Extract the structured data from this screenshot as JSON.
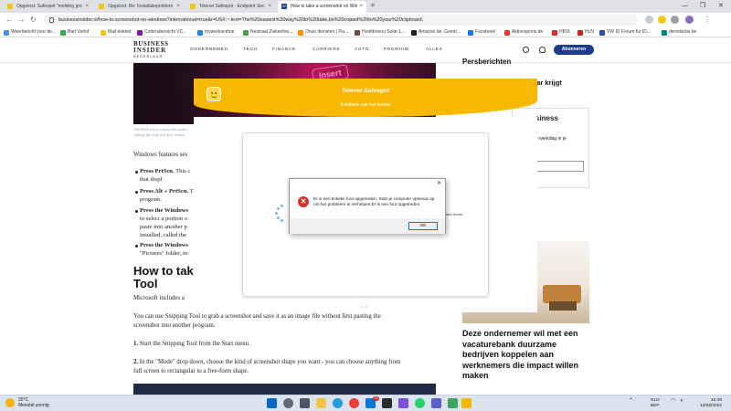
{
  "browser": {
    "tabs": [
      {
        "label": "Opgelost: Safespot \"melding gro",
        "color": "#f5c518"
      },
      {
        "label": "Opgelost: Re: Installatieproblem",
        "color": "#f5c518"
      },
      {
        "label": "Telenet Safespot - Endpoint Sec",
        "color": "#f5c518"
      },
      {
        "label": "How to take a screenshot on Win",
        "color": "#1d3b8b",
        "fav_text": "BI"
      }
    ],
    "url": "businessinsider.nl/how-to-screenshot-on-windows?international=true&r=US#:~:text=The%20easiest%20way%20to%20take,be%20copied%20to%20your%20clipboard.",
    "bookmarks": [
      {
        "label": "Weerbericht voor de...",
        "color": "#4a90d9"
      },
      {
        "label": "Bart Verlof",
        "color": "#34a853"
      },
      {
        "label": "Mail telenet",
        "color": "#f5c518"
      },
      {
        "label": "Coderubersicht VC...",
        "color": "#7b1fa2"
      },
      {
        "label": "mywerkandme",
        "color": "#1e88e5"
      },
      {
        "label": "Neutraal Ziekenfon...",
        "color": "#43a047"
      },
      {
        "label": "Onze diensten | Flu...",
        "color": "#fb8c00"
      },
      {
        "label": "Hoofdmenu Solar-L...",
        "color": "#6d4c41"
      },
      {
        "label": "Amazon.de: Goroti...",
        "color": "#222222"
      },
      {
        "label": "Facebook",
        "color": "#1877f2"
      },
      {
        "label": "Aktionspreis.de",
        "color": "#e53935"
      },
      {
        "label": "HBVL",
        "color": "#d32f2f"
      },
      {
        "label": "HLN",
        "color": "#c62828"
      },
      {
        "label": "VW ID Forum für ID...",
        "color": "#3949ab"
      },
      {
        "label": "deredactie.be",
        "color": "#00897b"
      }
    ]
  },
  "site": {
    "logo": {
      "line1": "BUSINESS",
      "line2": "INSIDER",
      "line3": "NEDERLAND"
    },
    "nav": [
      "ONDERNEMEN",
      "TECH",
      "FINANCE",
      "CARRIERE",
      "AUTO",
      "PREMIUM",
      "ALLES"
    ],
    "subscribe_label": "Abonneren",
    "brand_color": "#1d3b8b"
  },
  "article": {
    "hero_sign": "Insert",
    "caption": "The PrtScn key copies the entire... change the way this key works...",
    "intro": "Windows features sev",
    "bullets": [
      {
        "bold": "Press PrtScn.",
        "text": " This c",
        "line2": "that displ"
      },
      {
        "bold": "Press Alt + PrtScn.",
        "text": " T",
        "line2": "program."
      },
      {
        "bold": "Press the Windows",
        "text": "",
        "line2": "to select a portion o",
        "line3": "paste into another p",
        "line4": "installed, called the"
      },
      {
        "bold": "Press the Windows",
        "text": "",
        "line2": "\"Pictures\" folder, in"
      }
    ],
    "heading_line1": "How to take",
    "heading_line2": "Tool",
    "para1": "Microsoft includes a",
    "para2_line1": "You can use Snipping Tool to grab a screenshot and save it as an image file without first pasting the",
    "para2_line2": "screenshot into another program.",
    "step1_num": "1.",
    "step1": " Start the Snipping Tool from the Start menu.",
    "step2_num": "2.",
    "step2_line1": " In the \"Mode\" drop down, choose the kind of screenshot shape you want - you can choose anything from",
    "step2_line2": "full screen to rectangular to a free-form shape."
  },
  "sidebar": {
    "persbericht": "Persberichten",
    "teaser": "..., maar krijgt",
    "newsletter_title": "siness",
    "newsletter_text": "e werkdag in je",
    "promo": [
      "Deze ondernemer wil met een",
      "vacaturebank duurzame",
      "bedrijven koppelen aan",
      "werknemers die impact willen",
      "maken"
    ]
  },
  "safespot": {
    "title": "Telenet Safespot",
    "subtitle": "Installatie van het toestel",
    "minutes_text": "inuten duren.",
    "accent": "#f6b800"
  },
  "dialog": {
    "message": "Er is een kritieke fout opgetreden. Start je computer opnieuw op om het probleem te verhelpen.Er is een fout opgetreden",
    "ok_label": "OK",
    "close_symbol": "✕"
  },
  "taskbar": {
    "weather_temp": "20°C",
    "weather_desc": "Meestal zonnig",
    "lang1": "NLD",
    "lang2": "BEP",
    "time": "16:45",
    "date": "13/06/2022",
    "mail_badge": "19"
  }
}
